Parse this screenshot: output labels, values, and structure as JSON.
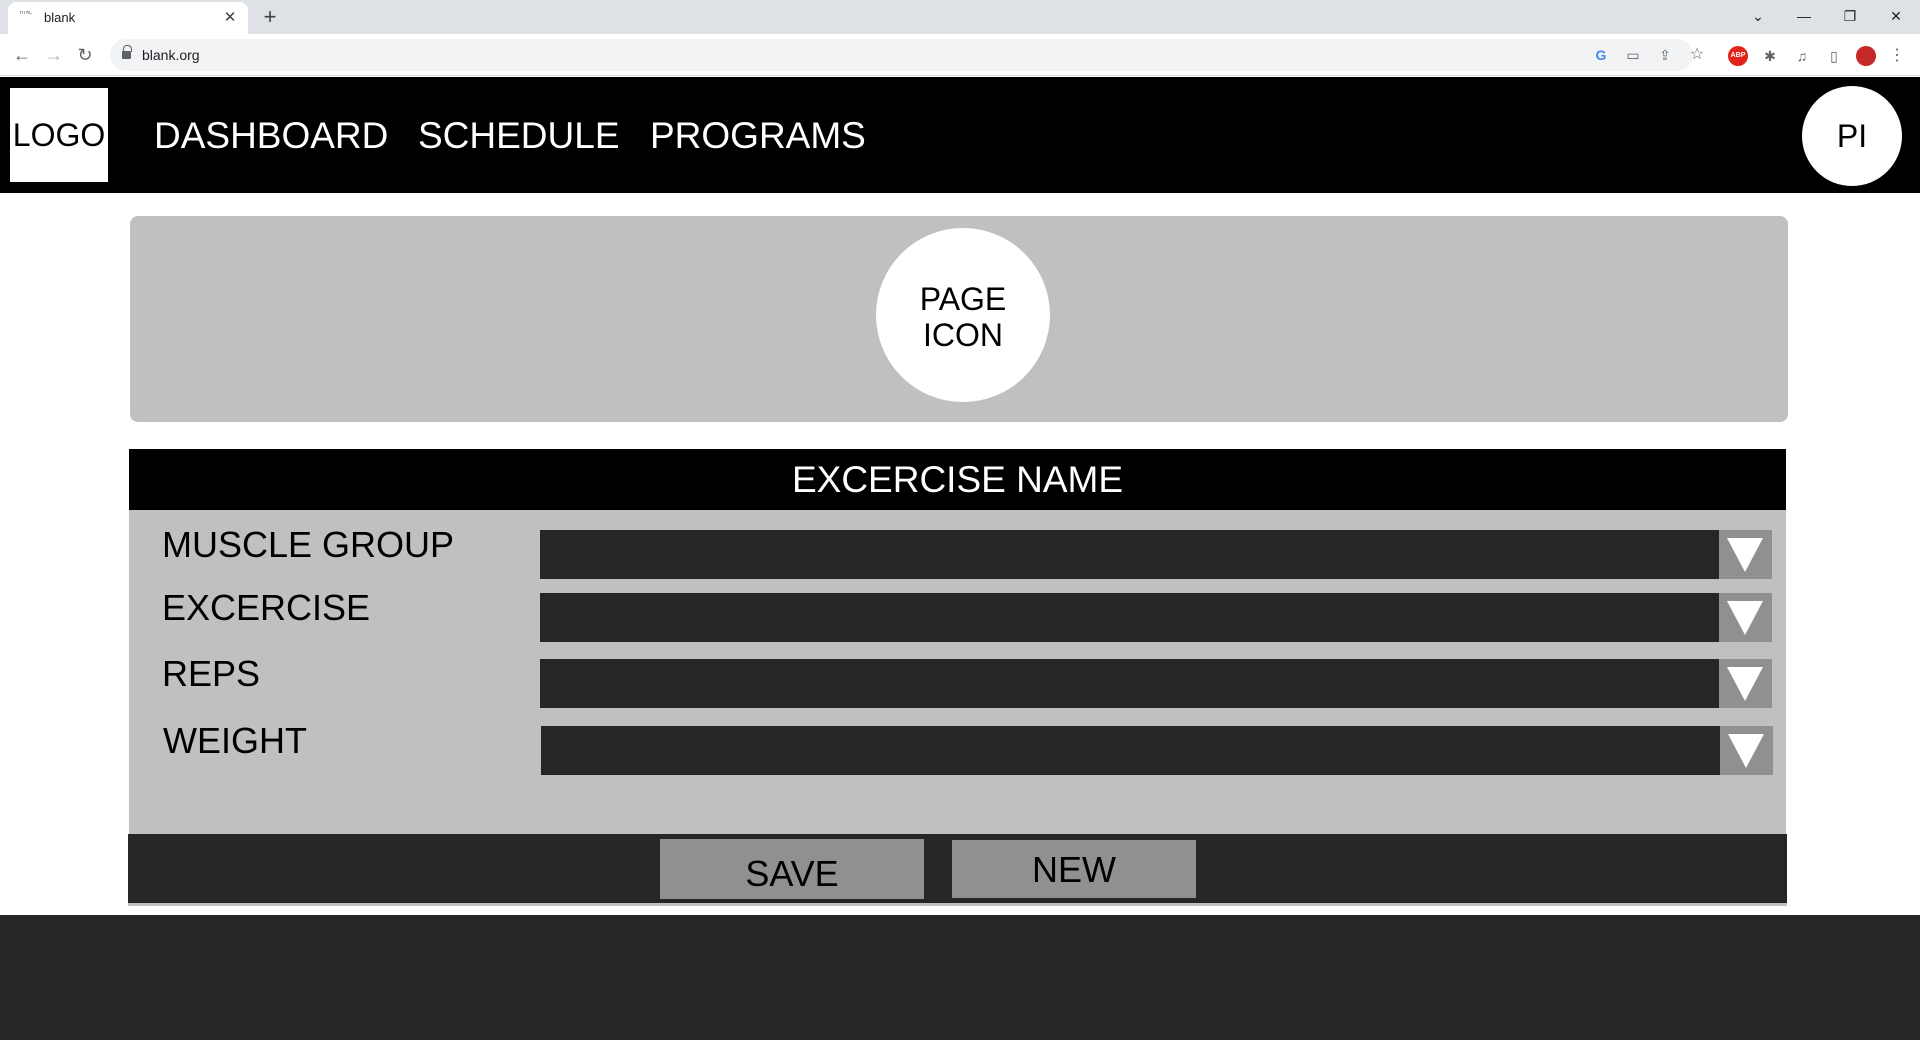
{
  "browser": {
    "tab": {
      "favicon": "HTML",
      "title": "blank",
      "close": "✕"
    },
    "new_tab": "+",
    "window_controls": {
      "tab_search": "⌄",
      "minimize": "—",
      "restore": "❐",
      "close": "✕"
    },
    "nav": {
      "back": "←",
      "forward": "→",
      "reload": "↻"
    },
    "address": {
      "url": "blank.org"
    },
    "omnibox_icons": {
      "google": "G",
      "tab": "▭",
      "share": "⇪",
      "bookmark": "☆"
    },
    "extensions": {
      "adblock": "ABP",
      "puzzle": "✱",
      "media": "♫",
      "sidepanel": "▯",
      "menu": "⋮"
    }
  },
  "header": {
    "logo": "LOGO",
    "nav": [
      "DASHBOARD",
      "SCHEDULE",
      "PROGRAMS"
    ],
    "profile_initials": "PI"
  },
  "hero": {
    "page_icon_line1": "PAGE",
    "page_icon_line2": "ICON"
  },
  "form": {
    "title": "EXCERCISE NAME",
    "fields": [
      {
        "label": "MUSCLE GROUP",
        "value": ""
      },
      {
        "label": "EXCERCISE",
        "value": ""
      },
      {
        "label": "REPS",
        "value": ""
      },
      {
        "label": "WEIGHT",
        "value": ""
      }
    ]
  },
  "actions": {
    "save": "SAVE",
    "new": "NEW"
  },
  "colors": {
    "header_bg": "#000000",
    "panel_bg": "#c0c0c0",
    "select_bg": "#262626",
    "button_bg": "#909090",
    "page_bg": "#ffffff",
    "footer_bg": "#262626"
  }
}
